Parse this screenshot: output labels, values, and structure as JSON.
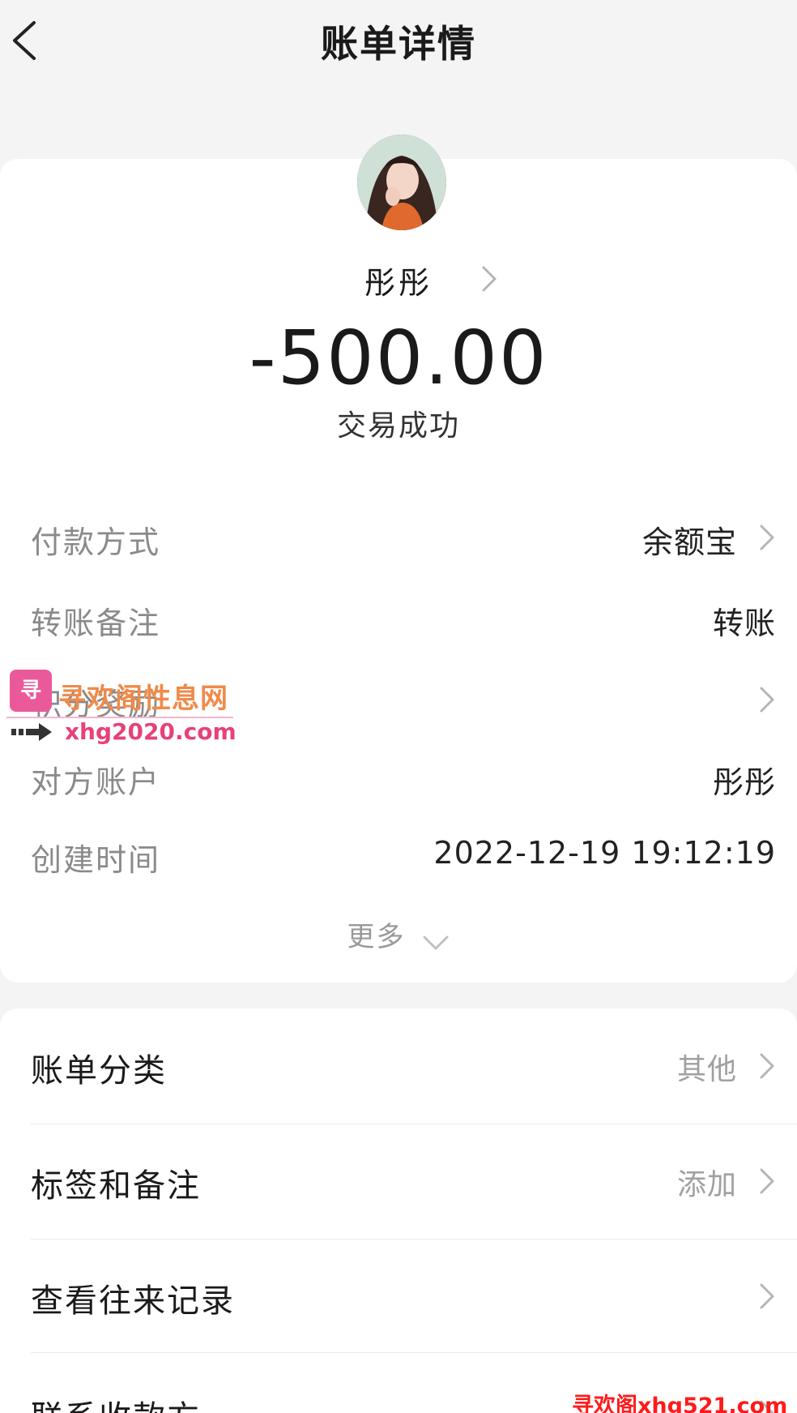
{
  "header": {
    "title": "账单详情",
    "back_icon": "chevron-left-icon"
  },
  "payee": {
    "name": "彤彤",
    "avatar_icon": "avatar-photo"
  },
  "transaction": {
    "amount": "-500.00",
    "status": "交易成功"
  },
  "details": [
    {
      "label": "付款方式",
      "value": "余额宝",
      "chevron": true
    },
    {
      "label": "转账备注",
      "value": "转账",
      "chevron": false
    },
    {
      "label": "积分奖励",
      "value": "",
      "chevron": true
    },
    {
      "label": "对方账户",
      "value": "彤彤",
      "chevron": false
    },
    {
      "label": "创建时间",
      "value": "2022-12-19 19:12:19",
      "chevron": false
    }
  ],
  "more": {
    "label": "更多"
  },
  "list": [
    {
      "label": "账单分类",
      "value": "其他"
    },
    {
      "label": "标签和备注",
      "value": "添加"
    },
    {
      "label": "查看往来记录",
      "value": ""
    },
    {
      "label": "联系收款方",
      "value": ""
    }
  ],
  "watermarks": {
    "badge": "寻",
    "text1": "寻欢阁性息网",
    "text2": "xhg2020.com",
    "bottom": "寻欢阁xhg521.com"
  },
  "colors": {
    "background": "#f4f4f4",
    "card": "#ffffff",
    "label_gray": "#8a8a8a",
    "value_gray": "#a0a0a0"
  }
}
